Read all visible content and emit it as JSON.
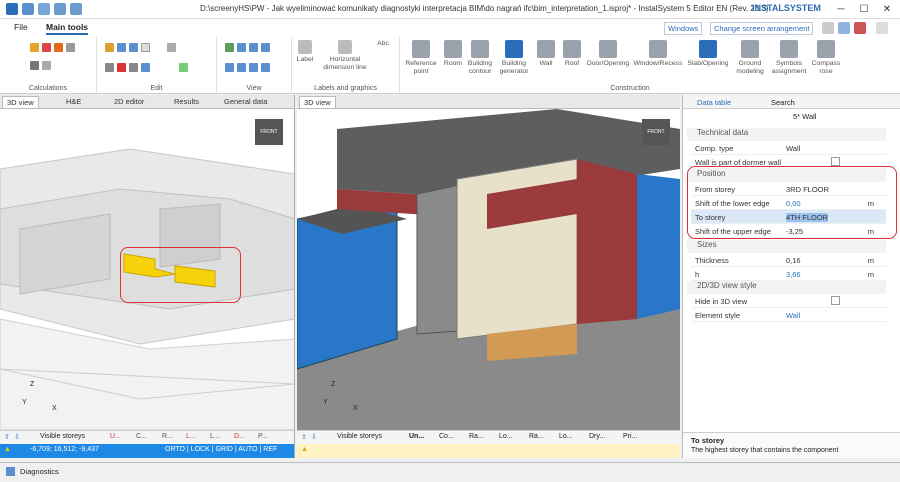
{
  "window": {
    "title": "D:\\screenyHS\\PW - Jak wyeliminować komunikaty diagnostyki interpretacja BIM\\do nagrań ifc\\bim_interpretation_1.isproj* - InstalSystem 5 Editor EN (Rev. 23.3)",
    "brand": "INSTALSYSTEM"
  },
  "menu": {
    "file": "File",
    "main_tools": "Main tools",
    "windows": "Windows",
    "screen_arrangement": "Change screen arrangement"
  },
  "ribbon": {
    "groups": [
      "Calculations",
      "Edit",
      "View",
      "Labels and graphics",
      "Construction"
    ],
    "label_btn": "Label",
    "hdim": "Horizontal dimension line",
    "abc": "Abc",
    "buttons": [
      "Reference point",
      "Room",
      "Building contour",
      "Building generator",
      "Wall",
      "Roof",
      "Door/Opening",
      "Window/Recess",
      "Slab/Opening",
      "Ground modeling",
      "Symbols assignment",
      "Compass rose"
    ]
  },
  "left_pane": {
    "tabs": [
      "3D view",
      "H&E",
      "2D editor",
      "Results",
      "General data"
    ],
    "visible_storeys": "Visible storeys",
    "chips": [
      "U...",
      "C...",
      "R...",
      "L...",
      "L...",
      "D...",
      "P..."
    ],
    "coords": "-6,709; 16,512; -9,437",
    "modes": "ORTO | LOCK | GRID | AUTO | REF"
  },
  "mid_pane": {
    "tab": "3D view",
    "visible_storeys": "Visible storeys",
    "chips": [
      "Un...",
      "Co...",
      "Ra...",
      "Lo...",
      "Ra...",
      "Lo...",
      "Dry...",
      "Pri..."
    ]
  },
  "right_pane": {
    "tabs": [
      "Data table",
      "Search"
    ],
    "header": "5* Wall",
    "sections": {
      "technical": "Technical data",
      "position": "Position",
      "sizes": "Sizes",
      "view": "2D/3D view style"
    },
    "rows": {
      "comp_type": {
        "k": "Comp. type",
        "v": "Wall"
      },
      "dormer": {
        "k": "Wall is part of dormer wall"
      },
      "from_storey": {
        "k": "From storey",
        "v": "3RD FLOOR"
      },
      "shift_lower": {
        "k": "Shift of the lower edge",
        "v": "0,00",
        "u": "m"
      },
      "to_storey": {
        "k": "To storey",
        "v": "4TH FLOOR"
      },
      "shift_upper": {
        "k": "Shift of the upper edge",
        "v": "-3,25",
        "u": "m"
      },
      "thickness": {
        "k": "Thickness",
        "v": "0,16",
        "u": "m"
      },
      "h": {
        "k": "h",
        "v": "3,66",
        "u": "m"
      },
      "hide3d": {
        "k": "Hide in 3D view"
      },
      "style": {
        "k": "Element style",
        "v": "Wall"
      }
    },
    "help_title": "To storey",
    "help_text": "The highest storey that contains the component"
  },
  "diagnostics": {
    "label": "Diagnostics"
  },
  "axes": {
    "x": "X",
    "y": "Y",
    "z": "Z"
  },
  "cube": "FRONT"
}
